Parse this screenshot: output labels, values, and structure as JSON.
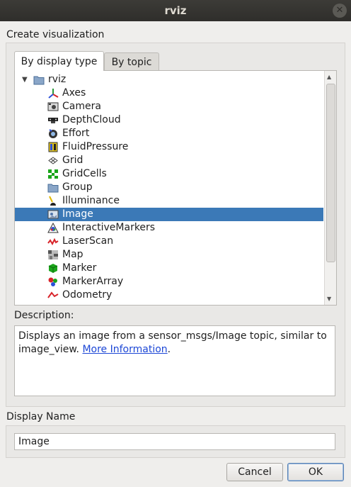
{
  "window": {
    "title": "rviz"
  },
  "dialog": {
    "header": "Create visualization",
    "tabs": [
      {
        "label": "By display type"
      },
      {
        "label": "By topic"
      }
    ],
    "tree": {
      "root": "rviz",
      "items": [
        {
          "label": "Axes",
          "icon": "axes-icon"
        },
        {
          "label": "Camera",
          "icon": "camera-icon"
        },
        {
          "label": "DepthCloud",
          "icon": "depthcloud-icon"
        },
        {
          "label": "Effort",
          "icon": "effort-icon"
        },
        {
          "label": "FluidPressure",
          "icon": "fluidpressure-icon"
        },
        {
          "label": "Grid",
          "icon": "grid-icon"
        },
        {
          "label": "GridCells",
          "icon": "gridcells-icon"
        },
        {
          "label": "Group",
          "icon": "folder-icon"
        },
        {
          "label": "Illuminance",
          "icon": "illuminance-icon"
        },
        {
          "label": "Image",
          "icon": "image-icon"
        },
        {
          "label": "InteractiveMarkers",
          "icon": "interactive-markers-icon"
        },
        {
          "label": "LaserScan",
          "icon": "laserscan-icon"
        },
        {
          "label": "Map",
          "icon": "map-icon"
        },
        {
          "label": "Marker",
          "icon": "marker-icon"
        },
        {
          "label": "MarkerArray",
          "icon": "markerarray-icon"
        },
        {
          "label": "Odometry",
          "icon": "odometry-icon"
        }
      ],
      "selected": "Image"
    },
    "description": {
      "label": "Description:",
      "text": "Displays an image from a sensor_msgs/Image topic, similar to image_view.",
      "link": "More Information",
      "after_link": "."
    },
    "display_name": {
      "label": "Display Name",
      "value": "Image"
    },
    "buttons": {
      "cancel": "Cancel",
      "ok": "OK"
    }
  },
  "colors": {
    "selection": "#3b79b7",
    "titlebar": "#3c3b37",
    "link": "#1c47d6"
  }
}
